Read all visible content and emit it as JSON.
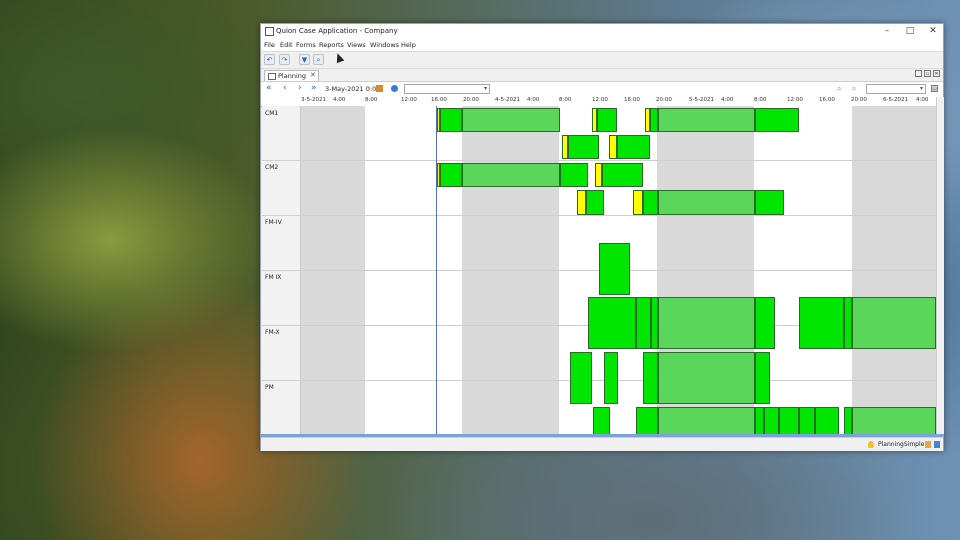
{
  "window": {
    "title": "Quion Case Application - Company"
  },
  "menu": [
    "File",
    "Edit",
    "Forms",
    "Reports",
    "Views",
    "Windows",
    "Help"
  ],
  "tab": {
    "label": "Planning"
  },
  "nav": {
    "date": "3-May-2021 0:00"
  },
  "timeline": {
    "ticks": [
      {
        "label": "3-5-2021"
      },
      {
        "label": "4:00"
      },
      {
        "label": "8:00"
      },
      {
        "label": "12:00"
      },
      {
        "label": "16:00"
      },
      {
        "label": "20:00"
      },
      {
        "label": "4-5-2021"
      },
      {
        "label": "4:00"
      },
      {
        "label": "8:00"
      },
      {
        "label": "12:00"
      },
      {
        "label": "16:00"
      },
      {
        "label": "20:00"
      },
      {
        "label": "5-5-2021"
      },
      {
        "label": "4:00"
      },
      {
        "label": "8:00"
      },
      {
        "label": "12:00"
      },
      {
        "label": "16:00"
      },
      {
        "label": "20:00"
      },
      {
        "label": "6-5-2021"
      },
      {
        "label": "4:00"
      }
    ]
  },
  "rows": [
    "CM1",
    "CM2",
    "FM-IV",
    "FM IX",
    "FM-X",
    "PM"
  ],
  "status": {
    "text": "PlanningSimple"
  },
  "colors": {
    "green": "#00e600",
    "yellow": "#ffff00",
    "grey": "#d9d9d9"
  }
}
